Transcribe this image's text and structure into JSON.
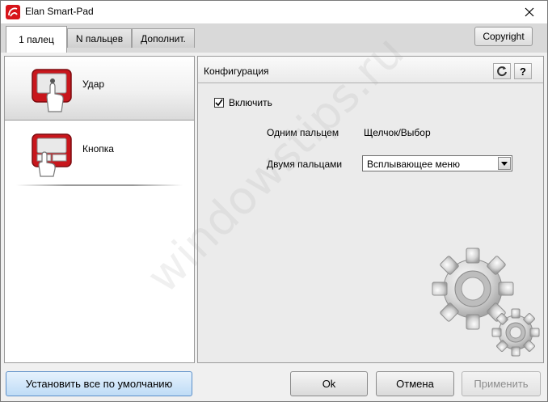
{
  "window": {
    "title": "Elan Smart-Pad"
  },
  "tabs": [
    {
      "label": "1 палец",
      "active": true
    },
    {
      "label": "N пальцев",
      "active": false
    },
    {
      "label": "Дополнит.",
      "active": false
    }
  ],
  "copyright_label": "Copyright",
  "gestures": [
    {
      "label": "Удар",
      "icon": "touchpad-tap-icon",
      "selected": true
    },
    {
      "label": "Кнопка",
      "icon": "touchpad-button-icon",
      "selected": false
    }
  ],
  "config": {
    "title": "Конфигурация",
    "refresh_icon": "refresh-icon",
    "help_label": "?",
    "enable_label": "Включить",
    "enable_checked": true,
    "one_finger_label": "Одним пальцем",
    "one_finger_value": "Щелчок/Выбор",
    "two_fingers_label": "Двумя пальцами",
    "two_fingers_value": "Всплывающее меню"
  },
  "buttons": {
    "defaults": "Установить все по умолчанию",
    "ok": "Ok",
    "cancel": "Отмена",
    "apply": "Применить"
  },
  "watermark": "windowstips.ru",
  "colors": {
    "accent_red": "#d7141a",
    "selected_blue": "#bfdcf6"
  }
}
